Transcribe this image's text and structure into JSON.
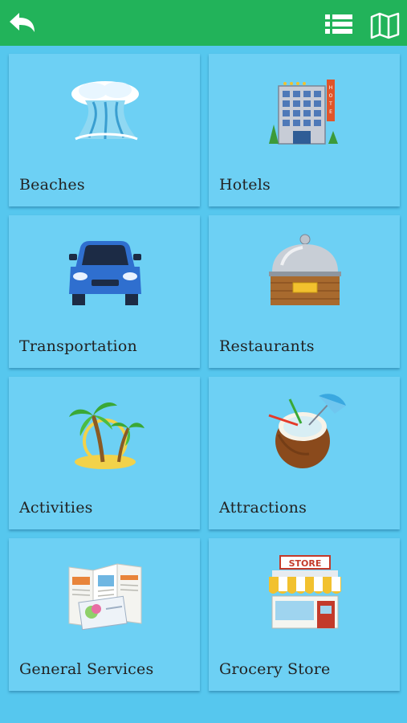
{
  "header": {
    "back_icon": "back-arrow-icon",
    "list_icon": "list-view-icon",
    "map_icon": "map-icon",
    "color": "#22b35a"
  },
  "background_color": "#56c7ee",
  "tile_color": "#6dd0f4",
  "tiles": [
    {
      "label": "Beaches",
      "icon": "wave-icon"
    },
    {
      "label": "Hotels",
      "icon": "hotel-building-icon"
    },
    {
      "label": "Transportation",
      "icon": "car-icon"
    },
    {
      "label": "Restaurants",
      "icon": "cloche-icon"
    },
    {
      "label": "Activities",
      "icon": "palm-island-icon"
    },
    {
      "label": "Attractions",
      "icon": "coconut-drink-icon"
    },
    {
      "label": "General Services",
      "icon": "brochure-icon"
    },
    {
      "label": "Grocery Store",
      "icon": "store-icon"
    }
  ]
}
